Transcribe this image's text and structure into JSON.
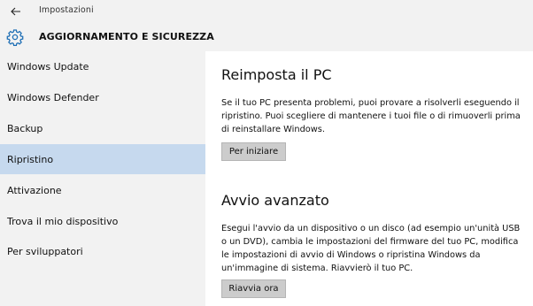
{
  "titlebar": {
    "title": "Impostazioni"
  },
  "header": {
    "title": "AGGIORNAMENTO E SICUREZZA",
    "icon": "gear-icon"
  },
  "sidebar": {
    "items": [
      {
        "label": "Windows Update"
      },
      {
        "label": "Windows Defender"
      },
      {
        "label": "Backup"
      },
      {
        "label": "Ripristino",
        "active": true
      },
      {
        "label": "Attivazione"
      },
      {
        "label": "Trova il mio dispositivo"
      },
      {
        "label": "Per sviluppatori"
      }
    ]
  },
  "reset": {
    "title": "Reimposta il PC",
    "text": "Se il tuo PC presenta problemi, puoi provare a risolverli eseguendo il ripristino. Puoi scegliere di mantenere i tuoi file o di rimuoverli prima di reinstallare Windows.",
    "button": "Per iniziare"
  },
  "advanced": {
    "title": "Avvio avanzato",
    "text": "Esegui l'avvio da un dispositivo o un disco (ad esempio un'unità USB o un DVD), cambia le impostazioni del firmware del tuo PC, modifica le impostazioni di avvio di Windows o ripristina Windows da un'immagine di sistema. Riavvierò il tuo PC.",
    "button": "Riavvia ora"
  },
  "colors": {
    "chrome_bg": "#f2f2f2",
    "active_item_bg": "#c6d9ee",
    "accent": "#1f6fb5",
    "button_bg": "#cccccc"
  }
}
